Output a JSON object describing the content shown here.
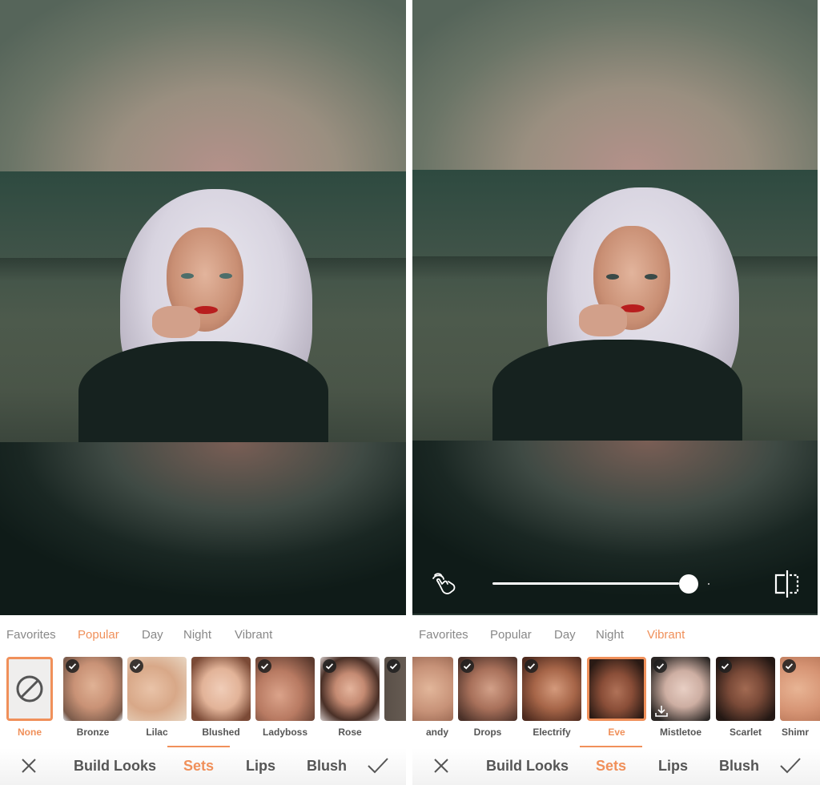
{
  "accent_color": "#f0905a",
  "panels": [
    {
      "id": "left",
      "show_slider": false,
      "tabs": [
        {
          "label": "Favorites",
          "active": false
        },
        {
          "label": "Popular",
          "active": true
        },
        {
          "label": "Day",
          "active": false
        },
        {
          "label": "Night",
          "active": false
        },
        {
          "label": "Vibrant",
          "active": false
        }
      ],
      "thumbnails": [
        {
          "label": "None",
          "selected": true,
          "icon": "no-filter-icon",
          "checked": false
        },
        {
          "label": "Bronze",
          "selected": false,
          "checked": true
        },
        {
          "label": "Lilac",
          "selected": false,
          "checked": true
        },
        {
          "label": "Blushed",
          "selected": false,
          "checked": false
        },
        {
          "label": "Ladyboss",
          "selected": false,
          "checked": true
        },
        {
          "label": "Rose",
          "selected": false,
          "checked": true
        },
        {
          "label": "",
          "selected": false,
          "checked": true
        }
      ]
    },
    {
      "id": "right",
      "show_slider": true,
      "slider_value": 0.9,
      "tabs": [
        {
          "label": "Favorites",
          "active": false
        },
        {
          "label": "Popular",
          "active": false
        },
        {
          "label": "Day",
          "active": false
        },
        {
          "label": "Night",
          "active": false
        },
        {
          "label": "Vibrant",
          "active": true
        }
      ],
      "thumbnails": [
        {
          "label": "andy",
          "selected": false,
          "checked": false
        },
        {
          "label": "Drops",
          "selected": false,
          "checked": true
        },
        {
          "label": "Electrify",
          "selected": false,
          "checked": true
        },
        {
          "label": "Eve",
          "selected": true,
          "checked": false
        },
        {
          "label": "Mistletoe",
          "selected": false,
          "checked": true,
          "download": true
        },
        {
          "label": "Scarlet",
          "selected": false,
          "checked": true
        },
        {
          "label": "Shimr",
          "selected": false,
          "checked": true
        }
      ]
    }
  ],
  "bottom_nav": {
    "close_icon": "close-icon",
    "items": [
      {
        "label": "Build Looks",
        "active": false
      },
      {
        "label": "Sets",
        "active": true
      },
      {
        "label": "Lips",
        "active": false
      },
      {
        "label": "Blush",
        "active": false
      }
    ],
    "confirm_icon": "check-icon"
  }
}
